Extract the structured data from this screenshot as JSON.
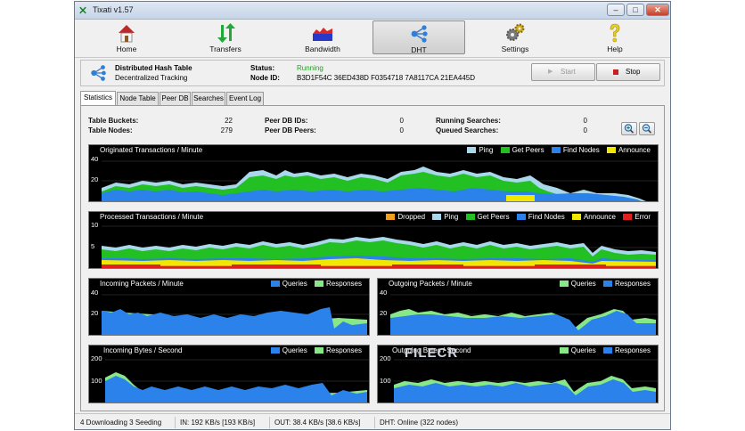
{
  "window": {
    "title": "Tixati v1.57",
    "min_glyph": "–",
    "max_glyph": "□",
    "close_glyph": "✕"
  },
  "toolbar": {
    "items": [
      {
        "label": "Home",
        "icon": "home-icon",
        "active": false
      },
      {
        "label": "Transfers",
        "icon": "transfers-icon",
        "active": false
      },
      {
        "label": "Bandwidth",
        "icon": "bandwidth-icon",
        "active": false
      },
      {
        "label": "DHT",
        "icon": "dht-icon",
        "active": true
      },
      {
        "label": "Settings",
        "icon": "settings-icon",
        "active": false
      },
      {
        "label": "Help",
        "icon": "help-icon",
        "active": false
      }
    ]
  },
  "info": {
    "title": "Distributed Hash Table",
    "subtitle": "Decentralized Tracking",
    "status_label": "Status:",
    "status_value": "Running",
    "node_id_label": "Node ID:",
    "node_id_value": "B3D1F54C 36ED438D F0354718 7A8117CA 21EA445D",
    "start_label": "Start",
    "stop_label": "Stop"
  },
  "tabs": [
    "Statistics",
    "Node Table",
    "Peer DB",
    "Searches",
    "Event Log"
  ],
  "stats": {
    "table_buckets_label": "Table Buckets:",
    "table_buckets": "22",
    "table_nodes_label": "Table Nodes:",
    "table_nodes": "279",
    "peer_db_ids_label": "Peer DB IDs:",
    "peer_db_ids": "0",
    "peer_db_peers_label": "Peer DB Peers:",
    "peer_db_peers": "0",
    "running_searches_label": "Running Searches:",
    "running_searches": "0",
    "queued_searches_label": "Queued Searches:",
    "queued_searches": "0"
  },
  "graphs": {
    "originated": {
      "title": "Originated Transactions / Minute",
      "y_labels": [
        "40",
        "20"
      ],
      "legend": [
        {
          "name": "Ping",
          "color": "#a8d8ea"
        },
        {
          "name": "Get Peers",
          "color": "#22c022"
        },
        {
          "name": "Find Nodes",
          "color": "#2a82ea"
        },
        {
          "name": "Announce",
          "color": "#f0e800"
        }
      ]
    },
    "processed": {
      "title": "Processed Transactions / Minute",
      "y_labels": [
        "10",
        "5"
      ],
      "legend": [
        {
          "name": "Dropped",
          "color": "#f0a020"
        },
        {
          "name": "Ping",
          "color": "#a8d8ea"
        },
        {
          "name": "Get Peers",
          "color": "#22c022"
        },
        {
          "name": "Find Nodes",
          "color": "#2a82ea"
        },
        {
          "name": "Announce",
          "color": "#f0e800"
        },
        {
          "name": "Error",
          "color": "#e02020"
        }
      ]
    },
    "incoming_packets": {
      "title": "Incoming Packets / Minute",
      "y_labels": [
        "40",
        "20"
      ],
      "legend": [
        {
          "name": "Queries",
          "color": "#2a82ea"
        },
        {
          "name": "Responses",
          "color": "#88e888"
        }
      ]
    },
    "outgoing_packets": {
      "title": "Outgoing Packets / Minute",
      "y_labels": [
        "40",
        "20"
      ],
      "legend": [
        {
          "name": "Queries",
          "color": "#88e888"
        },
        {
          "name": "Responses",
          "color": "#2a82ea"
        }
      ]
    },
    "incoming_bytes": {
      "title": "Incoming Bytes / Second",
      "y_labels": [
        "200",
        "100"
      ],
      "legend": [
        {
          "name": "Queries",
          "color": "#2a82ea"
        },
        {
          "name": "Responses",
          "color": "#88e888"
        }
      ]
    },
    "outgoing_bytes": {
      "title": "Outgoing Bytes / Second",
      "y_labels": [
        "200",
        "100"
      ],
      "legend": [
        {
          "name": "Queries",
          "color": "#88e888"
        },
        {
          "name": "Responses",
          "color": "#2a82ea"
        }
      ]
    }
  },
  "watermark": "FILECR",
  "statusbar": {
    "transfers": "4 Downloading  3 Seeding",
    "incoming": "IN: 192 KB/s [193 KB/s]",
    "outgoing": "OUT: 38.4 KB/s [38.6 KB/s]",
    "dht": "DHT: Online (322 nodes)"
  }
}
